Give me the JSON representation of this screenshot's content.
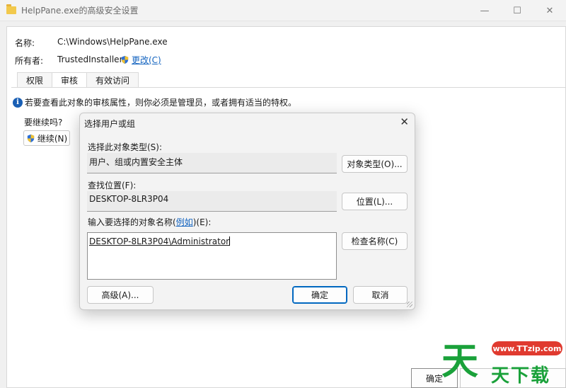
{
  "window": {
    "title": "HelpPane.exe的高级安全设置",
    "minimize_glyph": "—",
    "maximize_glyph": "☐",
    "close_glyph": "✕"
  },
  "properties": {
    "name_label": "名称:",
    "name_value": "C:\\Windows\\HelpPane.exe",
    "owner_label": "所有者:",
    "owner_value": "TrustedInstaller",
    "change_link": "更改(C)"
  },
  "tabs": [
    {
      "label": "权限"
    },
    {
      "label": "审核"
    },
    {
      "label": "有效访问"
    }
  ],
  "audit": {
    "info_text": "若要查看此对象的审核属性，则你必须是管理员，或者拥有适当的特权。",
    "continue_question": "要继续吗?",
    "continue_button": "继续(N)"
  },
  "footer": {
    "ok": "确定"
  },
  "dialog": {
    "title": "选择用户或组",
    "object_type_label": "选择此对象类型(S):",
    "object_type_value": "用户、组或内置安全主体",
    "object_type_button": "对象类型(O)...",
    "location_label": "查找位置(F):",
    "location_value": "DESKTOP-8LR3P04",
    "location_button": "位置(L)...",
    "names_label_prefix": "输入要选择的对象名称(",
    "names_label_link": "例如",
    "names_label_suffix": ")(E):",
    "names_value": "DESKTOP-8LR3P04\\Administrator",
    "check_names_button": "检查名称(C)",
    "advanced_button": "高级(A)...",
    "ok_button": "确定",
    "cancel_button": "取消"
  },
  "watermark": {
    "url": "www.TTzip.com",
    "big_char": "天",
    "small_text": "天下载"
  },
  "colors": {
    "accent": "#0067c0",
    "link": "#1565c0",
    "info": "#1a5fb4",
    "watermark_green": "#1aa13a",
    "watermark_red": "#e03a2f"
  }
}
